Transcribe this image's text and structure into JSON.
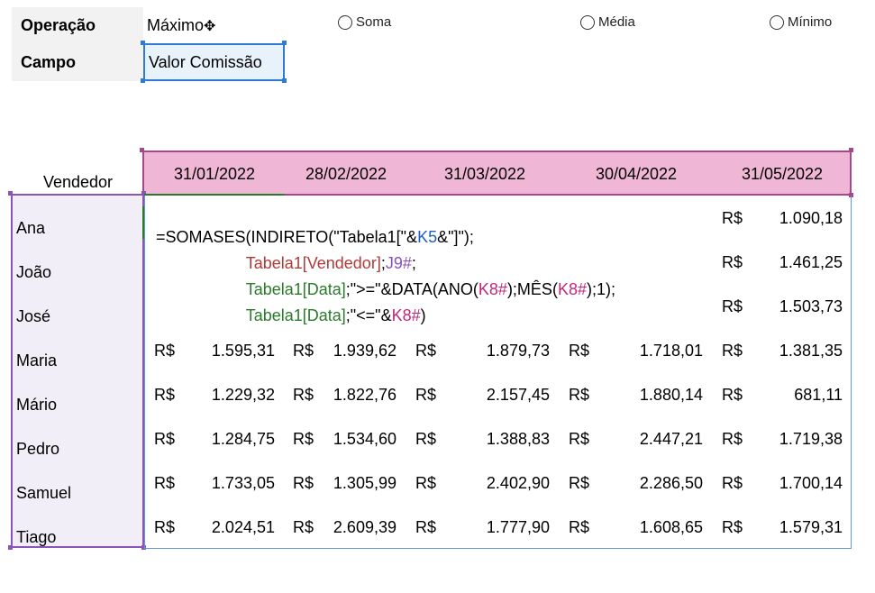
{
  "params": {
    "operation_label": "Operação",
    "operation_value": "Máximo",
    "field_label": "Campo",
    "field_value": "Valor Comissão"
  },
  "radios": [
    {
      "label": "Soma",
      "checked": false
    },
    {
      "label": "Média",
      "checked": false
    },
    {
      "label": "Mínimo",
      "checked": false
    }
  ],
  "table": {
    "vendedor_header": "Vendedor",
    "dates": [
      "31/01/2022",
      "28/02/2022",
      "31/03/2022",
      "30/04/2022",
      "31/05/2022"
    ],
    "names": [
      "Ana",
      "João",
      "José",
      "Maria",
      "Mário",
      "Pedro",
      "Samuel",
      "Tiago"
    ],
    "currency": "R$",
    "partial_values": [
      "1.090,18",
      "1.461,25",
      "1.503,73"
    ],
    "rows": [
      [
        "1.595,31",
        "1.939,62",
        "1.879,73",
        "1.718,01",
        "1.381,35"
      ],
      [
        "1.229,32",
        "1.822,76",
        "2.157,45",
        "1.880,14",
        "681,11"
      ],
      [
        "1.284,75",
        "1.534,60",
        "1.388,83",
        "2.447,21",
        "1.719,38"
      ],
      [
        "1.733,05",
        "1.305,99",
        "2.402,90",
        "2.286,50",
        "1.700,14"
      ],
      [
        "2.024,51",
        "2.609,39",
        "1.777,90",
        "1.608,65",
        "1.579,31"
      ]
    ]
  },
  "formula": {
    "l1_a": "=SOMASES(INDIRETO(\"Tabela1[\"&",
    "l1_ref": "K5",
    "l1_b": "&\"]\");",
    "l2_a": "Tabela1[Vendedor]",
    "l2_b": ";",
    "l2_ref": "J9#",
    "l2_c": ";",
    "l3_a": "Tabela1[Data]",
    "l3_b": ";\">=\"&DATA(ANO(",
    "l3_ref1": "K8#",
    "l3_c": ");MÊS(",
    "l3_ref2": "K8#",
    "l3_d": ");1);",
    "l4_a": "Tabela1[Data]",
    "l4_b": ";\"<=\"&",
    "l4_ref": "K8#",
    "l4_c": ")"
  }
}
